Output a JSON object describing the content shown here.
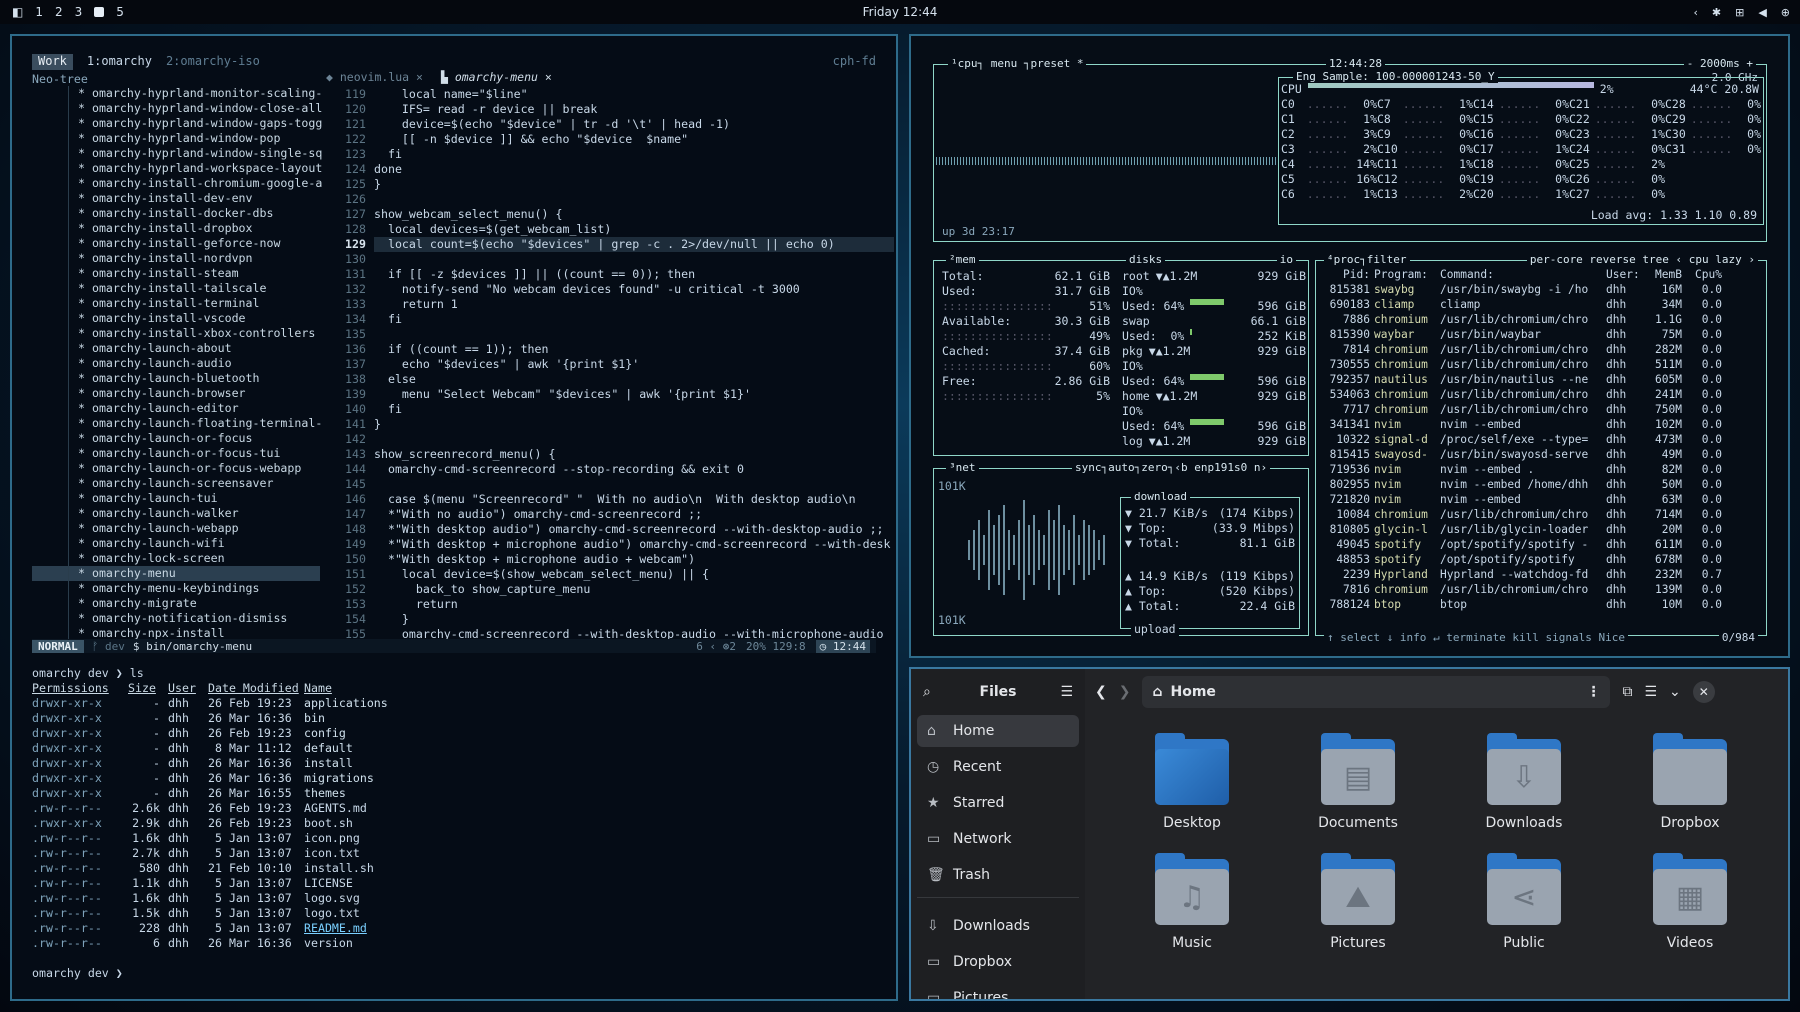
{
  "topbar": {
    "workspaces": [
      "1",
      "2",
      "3",
      "5"
    ],
    "clock": "Friday 12:44",
    "tray": [
      "‹",
      "✱",
      "⊞",
      "◀",
      "⊕"
    ]
  },
  "nvim": {
    "tabs": {
      "work": "Work",
      "t1": "1:omarchy",
      "t2": "2:omarchy-iso",
      "right": "cph-fd"
    },
    "neotree_title": "Neo-tree",
    "tree": [
      "omarchy-hyprland-monitor-scaling-",
      "omarchy-hyprland-window-close-all",
      "omarchy-hyprland-window-gaps-togg",
      "omarchy-hyprland-window-pop",
      "omarchy-hyprland-window-single-sq",
      "omarchy-hyprland-workspace-layout",
      "omarchy-install-chromium-google-a",
      "omarchy-install-dev-env",
      "omarchy-install-docker-dbs",
      "omarchy-install-dropbox",
      "omarchy-install-geforce-now",
      "omarchy-install-nordvpn",
      "omarchy-install-steam",
      "omarchy-install-tailscale",
      "omarchy-install-terminal",
      "omarchy-install-vscode",
      "omarchy-install-xbox-controllers",
      "omarchy-launch-about",
      "omarchy-launch-audio",
      "omarchy-launch-bluetooth",
      "omarchy-launch-browser",
      "omarchy-launch-editor",
      "omarchy-launch-floating-terminal-",
      "omarchy-launch-or-focus",
      "omarchy-launch-or-focus-tui",
      "omarchy-launch-or-focus-webapp",
      "omarchy-launch-screensaver",
      "omarchy-launch-tui",
      "omarchy-launch-walker",
      "omarchy-launch-webapp",
      "omarchy-launch-wifi",
      "omarchy-lock-screen",
      "omarchy-menu",
      "omarchy-menu-keybindings",
      "omarchy-migrate",
      "omarchy-notification-dismiss",
      "omarchy-npx-install"
    ],
    "buffers": [
      "neovim.lua",
      "omarchy-menu"
    ],
    "line_numbers": [
      "119",
      "120",
      "121",
      "122",
      "123",
      "124",
      "125",
      "126",
      "127",
      "128",
      "129",
      "130",
      "131",
      "132",
      "133",
      "134",
      "135",
      "136",
      "137",
      "138",
      "139",
      "140",
      "141",
      "142",
      "143",
      "144",
      "145",
      "146",
      "147",
      "148",
      "149",
      "150",
      "151",
      "152",
      "153",
      "154",
      "155"
    ],
    "code": [
      "    local name=\"$line\"",
      "    IFS= read -r device || break",
      "    device=$(echo \"$device\" | tr -d '\\t' | head -1)",
      "    [[ -n $device ]] && echo \"$device  $name\"",
      "  fi",
      "done",
      "}",
      "",
      "show_webcam_select_menu() {",
      "  local devices=$(get_webcam_list)",
      "  local count=$(echo \"$devices\" | grep -c . 2>/dev/null || echo 0)",
      "",
      "  if [[ -z $devices ]] || ((count == 0)); then",
      "    notify-send \"No webcam devices found\" -u critical -t 3000",
      "    return 1",
      "  fi",
      "",
      "  if ((count == 1)); then",
      "    echo \"$devices\" | awk '{print $1}'",
      "  else",
      "    menu \"Select Webcam\" \"$devices\" | awk '{print $1}'",
      "  fi",
      "}",
      "",
      "show_screenrecord_menu() {",
      "  omarchy-cmd-screenrecord --stop-recording && exit 0",
      "",
      "  case $(menu \"Screenrecord\" \"  With no audio\\n  With desktop audio\\n",
      "  *\"With no audio\") omarchy-cmd-screenrecord ;;",
      "  *\"With desktop audio\") omarchy-cmd-screenrecord --with-desktop-audio ;;",
      "  *\"With desktop + microphone audio\") omarchy-cmd-screenrecord --with-desk",
      "  *\"With desktop + microphone audio + webcam\")",
      "    local device=$(show_webcam_select_menu) || {",
      "      back_to show_capture_menu",
      "      return",
      "    }",
      "    omarchy-cmd-screenrecord --with-desktop-audio --with-microphone-audio"
    ],
    "status": {
      "mode": "NORMAL",
      "branch": "dev",
      "file": "$  bin/omarchy-menu",
      "diag": "6 ‹ ⊛2",
      "pos": "20% 129:8",
      "time": "12:44"
    },
    "term": {
      "prompt1": "omarchy dev ❯ ls",
      "headers": [
        "Permissions",
        "Size",
        "User",
        "Date Modified",
        "Name"
      ],
      "rows": [
        [
          "drwxr-xr-x",
          "-",
          "dhh",
          "26 Feb 19:23",
          "applications"
        ],
        [
          "drwxr-xr-x",
          "-",
          "dhh",
          "26 Mar 16:36",
          "bin"
        ],
        [
          "drwxr-xr-x",
          "-",
          "dhh",
          "26 Feb 19:23",
          "config"
        ],
        [
          "drwxr-xr-x",
          "-",
          "dhh",
          " 8 Mar 11:12",
          "default"
        ],
        [
          "drwxr-xr-x",
          "-",
          "dhh",
          "26 Mar 16:36",
          "install"
        ],
        [
          "drwxr-xr-x",
          "-",
          "dhh",
          "26 Mar 16:36",
          "migrations"
        ],
        [
          "drwxr-xr-x",
          "-",
          "dhh",
          "26 Mar 16:55",
          "themes"
        ],
        [
          ".rw-r--r--",
          "2.6k",
          "dhh",
          "26 Feb 19:23",
          "AGENTS.md"
        ],
        [
          ".rwxr-xr-x",
          "2.9k",
          "dhh",
          "26 Feb 19:23",
          "boot.sh"
        ],
        [
          ".rw-r--r--",
          "1.6k",
          "dhh",
          " 5 Jan 13:07",
          "icon.png"
        ],
        [
          ".rw-r--r--",
          "2.7k",
          "dhh",
          " 5 Jan 13:07",
          "icon.txt"
        ],
        [
          ".rw-r--r--",
          "580",
          "dhh",
          "21 Feb 10:10",
          "install.sh"
        ],
        [
          ".rw-r--r--",
          "1.1k",
          "dhh",
          " 5 Jan 13:07",
          "LICENSE"
        ],
        [
          ".rw-r--r--",
          "1.6k",
          "dhh",
          " 5 Jan 13:07",
          "logo.svg"
        ],
        [
          ".rw-r--r--",
          "1.5k",
          "dhh",
          " 5 Jan 13:07",
          "logo.txt"
        ],
        [
          ".rw-r--r--",
          "228",
          "dhh",
          " 5 Jan 13:07",
          "README.md"
        ],
        [
          ".rw-r--r--",
          "6",
          "dhh",
          "26 Mar 16:36",
          "version"
        ]
      ],
      "prompt2": "omarchy dev ❯"
    }
  },
  "btop": {
    "cpu": {
      "title": "¹cpu",
      "menu": "menu",
      "preset": "preset *",
      "time": "12:44:28",
      "ms": "- 2000ms +",
      "ghz": "2.0 GHz",
      "sample": "Eng Sample: 100-000001243-50_Y",
      "uptime": "up 3d 23:17",
      "total": "CPU",
      "total_pct": "2%",
      "temp": "44°C 20.8W",
      "cores": [
        [
          "C0",
          "0%"
        ],
        [
          "C1",
          "1%"
        ],
        [
          "C2",
          "3%"
        ],
        [
          "C3",
          "2%"
        ],
        [
          "C4",
          "14%"
        ],
        [
          "C5",
          "16%"
        ],
        [
          "C6",
          "1%"
        ],
        [
          "C7",
          "1%"
        ],
        [
          "C8",
          "0%"
        ],
        [
          "C9",
          "0%"
        ],
        [
          "C10",
          "0%"
        ],
        [
          "C11",
          "1%"
        ],
        [
          "C12",
          "0%"
        ],
        [
          "C13",
          "2%"
        ],
        [
          "C14",
          "0%"
        ],
        [
          "C15",
          "0%"
        ],
        [
          "C16",
          "0%"
        ],
        [
          "C17",
          "1%"
        ],
        [
          "C18",
          "0%"
        ],
        [
          "C19",
          "0%"
        ],
        [
          "C20",
          "1%"
        ],
        [
          "C21",
          "0%"
        ],
        [
          "C22",
          "0%"
        ],
        [
          "C23",
          "1%"
        ],
        [
          "C24",
          "0%"
        ],
        [
          "C25",
          "2%"
        ],
        [
          "C26",
          "0%"
        ],
        [
          "C27",
          "0%"
        ],
        [
          "C28",
          "0%"
        ],
        [
          "C29",
          "0%"
        ],
        [
          "C30",
          "0%"
        ],
        [
          "C31",
          "0%"
        ]
      ],
      "load": "Load avg: 1.33 1.10 0.89"
    },
    "mem": {
      "title": "²mem",
      "rows": [
        [
          "Total:",
          "62.1 GiB"
        ],
        [
          "Used:",
          "31.7 GiB"
        ],
        [
          "",
          "51%"
        ],
        [
          "Available:",
          "30.3 GiB"
        ],
        [
          "",
          "49%"
        ],
        [
          "Cached:",
          "37.4 GiB"
        ],
        [
          "",
          "60%"
        ],
        [
          "Free:",
          "2.86 GiB"
        ],
        [
          "",
          "5%"
        ]
      ]
    },
    "disks": {
      "title": "disks",
      "io": "io",
      "rows": [
        [
          "root",
          "▼▲1.2M",
          "929 GiB"
        ],
        [
          "IO%",
          "",
          ""
        ],
        [
          "Used: 64%",
          "",
          "596 GiB"
        ],
        [
          "swap",
          "",
          "66.1 GiB"
        ],
        [
          "Used:  0%",
          "",
          "252 KiB"
        ],
        [
          "pkg",
          "▼▲1.2M",
          "929 GiB"
        ],
        [
          "IO%",
          "",
          ""
        ],
        [
          "Used: 64%",
          "",
          "596 GiB"
        ],
        [
          "home",
          "▼▲1.2M",
          "929 GiB"
        ],
        [
          "IO%",
          "",
          ""
        ],
        [
          "Used: 64%",
          "",
          "596 GiB"
        ],
        [
          "log",
          "▼▲1.2M",
          "929 GiB"
        ]
      ]
    },
    "net": {
      "title": "³net",
      "sync": "sync",
      "auto": "auto",
      "zero": "zero",
      "iface": "‹b enp191s0 n›",
      "top": "101K",
      "bottom": "101K",
      "download": "download",
      "dl": [
        [
          "▼ 21.7 KiB/s",
          "(174 Kibps)"
        ],
        [
          "▼ Top:",
          "(33.9 Mibps)"
        ],
        [
          "▼ Total:",
          "81.1 GiB"
        ]
      ],
      "ul": [
        [
          "▲ 14.9 KiB/s",
          "(119 Kibps)"
        ],
        [
          "▲ Top:",
          "(520 Kibps)"
        ],
        [
          "▲ Total:",
          "22.4 GiB"
        ]
      ],
      "upload": "upload"
    },
    "proc": {
      "title": "⁴proc",
      "filter": "filter",
      "opts": "per-core reverse tree ‹ cpu lazy ›",
      "headers": [
        "Pid:",
        "Program:",
        "Command:",
        "User:",
        "MemB",
        "Cpu%"
      ],
      "rows": [
        [
          "815381",
          "swaybg",
          "/usr/bin/swaybg -i /ho",
          "dhh",
          "16M",
          "0.0"
        ],
        [
          "690183",
          "cliamp",
          "cliamp",
          "dhh",
          "34M",
          "0.0"
        ],
        [
          "7886",
          "chromium",
          "/usr/lib/chromium/chro",
          "dhh",
          "1.1G",
          "0.0"
        ],
        [
          "815390",
          "waybar",
          "/usr/bin/waybar",
          "dhh",
          "75M",
          "0.0"
        ],
        [
          "7814",
          "chromium",
          "/usr/lib/chromium/chro",
          "dhh",
          "282M",
          "0.0"
        ],
        [
          "730555",
          "chromium",
          "/usr/lib/chromium/chro",
          "dhh",
          "511M",
          "0.0"
        ],
        [
          "792357",
          "nautilus",
          "/usr/bin/nautilus --ne",
          "dhh",
          "605M",
          "0.0"
        ],
        [
          "534063",
          "chromium",
          "/usr/lib/chromium/chro",
          "dhh",
          "241M",
          "0.0"
        ],
        [
          "7717",
          "chromium",
          "/usr/lib/chromium/chro",
          "dhh",
          "750M",
          "0.0"
        ],
        [
          "341341",
          "nvim",
          "nvim --embed",
          "dhh",
          "102M",
          "0.0"
        ],
        [
          "10322",
          "signal-d",
          "/proc/self/exe --type=",
          "dhh",
          "473M",
          "0.0"
        ],
        [
          "815415",
          "swayosd-",
          "/usr/bin/swayosd-serve",
          "dhh",
          "49M",
          "0.0"
        ],
        [
          "719536",
          "nvim",
          "nvim --embed .",
          "dhh",
          "82M",
          "0.0"
        ],
        [
          "802955",
          "nvim",
          "nvim --embed /home/dhh",
          "dhh",
          "50M",
          "0.0"
        ],
        [
          "721820",
          "nvim",
          "nvim --embed",
          "dhh",
          "63M",
          "0.0"
        ],
        [
          "10084",
          "chromium",
          "/usr/lib/chromium/chro",
          "dhh",
          "714M",
          "0.0"
        ],
        [
          "810805",
          "glycin-l",
          "/usr/lib/glycin-loader",
          "dhh",
          "20M",
          "0.0"
        ],
        [
          "49045",
          "spotify",
          "/opt/spotify/spotify -",
          "dhh",
          "611M",
          "0.0"
        ],
        [
          "48853",
          "spotify",
          "/opt/spotify/spotify",
          "dhh",
          "678M",
          "0.0"
        ],
        [
          "2239",
          "Hyprland",
          "Hyprland --watchdog-fd",
          "dhh",
          "232M",
          "0.7"
        ],
        [
          "7816",
          "chromium",
          "/usr/lib/chromium/chro",
          "dhh",
          "139M",
          "0.0"
        ],
        [
          "788124",
          "btop",
          "btop",
          "dhh",
          "10M",
          "0.0"
        ]
      ],
      "footer": "↑ select ↓  info ↵  terminate  kill  signals  Nice",
      "count": "0/984"
    }
  },
  "files": {
    "title": "Files",
    "location": "Home",
    "sidebar": [
      {
        "label": "Home",
        "icon": "⌂"
      },
      {
        "label": "Recent",
        "icon": "◷"
      },
      {
        "label": "Starred",
        "icon": "★"
      },
      {
        "label": "Network",
        "icon": "▭"
      },
      {
        "label": "Trash",
        "icon": "🗑"
      }
    ],
    "sidebar2": [
      {
        "label": "Downloads",
        "icon": "⇩"
      },
      {
        "label": "Dropbox",
        "icon": "▭"
      },
      {
        "label": "Pictures",
        "icon": "▭"
      }
    ],
    "items": [
      {
        "label": "Desktop",
        "icon": ""
      },
      {
        "label": "Documents",
        "icon": "▤"
      },
      {
        "label": "Downloads",
        "icon": "⇩"
      },
      {
        "label": "Dropbox",
        "icon": ""
      },
      {
        "label": "Music",
        "icon": "♫"
      },
      {
        "label": "Pictures",
        "icon": "⛰"
      },
      {
        "label": "Public",
        "icon": "⋖"
      },
      {
        "label": "Videos",
        "icon": "▦"
      }
    ]
  },
  "colors": {
    "accent": "#2f77c6",
    "border": "#2e6b8a",
    "btop_box": "#8fd6c8"
  }
}
